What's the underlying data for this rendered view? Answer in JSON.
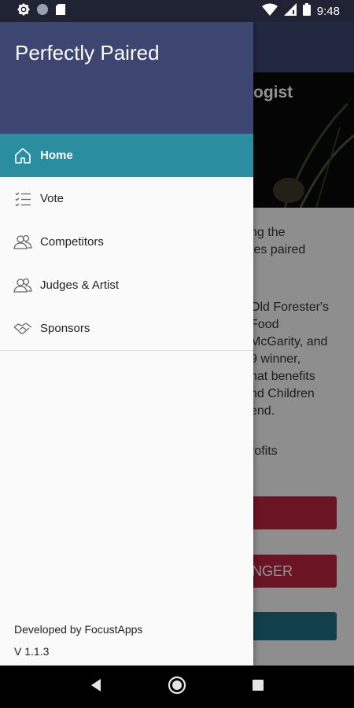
{
  "status_bar": {
    "time": "9:48",
    "icons": [
      "settings-icon",
      "circle-icon",
      "sd-card-icon",
      "wifi-icon",
      "signal-icon",
      "battery-icon"
    ]
  },
  "background": {
    "hero_title": "ogist",
    "text_lines": [
      "ng the",
      "tes paired",
      "Old Forester's",
      "Food",
      "McGarity, and",
      "9 winner,",
      "hat benefits",
      "nd Children",
      "end.",
      "rofits"
    ],
    "buttons": [
      {
        "label": "",
        "color": "#b8243e"
      },
      {
        "label": "NGER",
        "color": "#b8243e"
      },
      {
        "label": "",
        "color": "#1f6f80"
      }
    ]
  },
  "drawer": {
    "title": "Perfectly Paired",
    "header_color": "#3d4670",
    "active_color": "#2a8ea0",
    "menu": [
      {
        "label": "Home",
        "icon": "home-icon",
        "active": true
      },
      {
        "label": "Vote",
        "icon": "checklist-icon",
        "active": false
      },
      {
        "label": "Competitors",
        "icon": "people-icon",
        "active": false
      },
      {
        "label": "Judges & Artist",
        "icon": "people-icon",
        "active": false
      },
      {
        "label": "Sponsors",
        "icon": "handshake-icon",
        "active": false
      }
    ],
    "footer": {
      "developer": "Developed by FocustApps",
      "version": "V 1.1.3"
    }
  },
  "nav_bar": {
    "buttons": [
      "back-icon",
      "home-circle-icon",
      "recents-icon"
    ]
  }
}
